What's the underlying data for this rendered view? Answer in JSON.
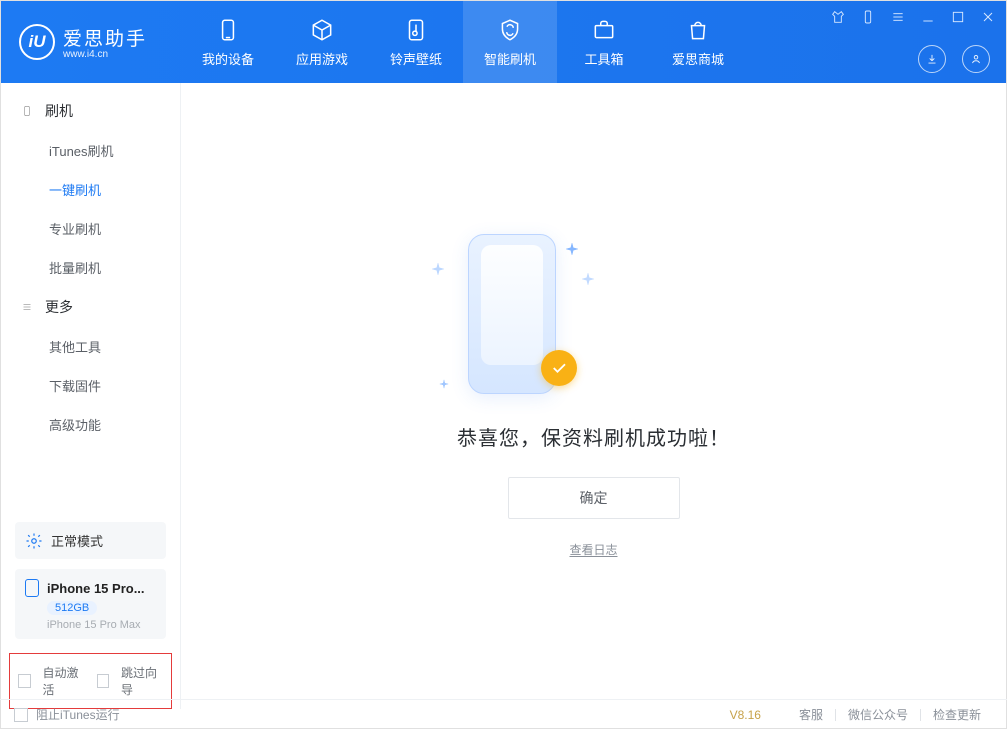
{
  "app": {
    "name": "爱思助手",
    "site": "www.i4.cn"
  },
  "nav": {
    "items": [
      {
        "label": "我的设备"
      },
      {
        "label": "应用游戏"
      },
      {
        "label": "铃声壁纸"
      },
      {
        "label": "智能刷机"
      },
      {
        "label": "工具箱"
      },
      {
        "label": "爱思商城"
      }
    ]
  },
  "sidebar": {
    "group1": "刷机",
    "items1": [
      {
        "label": "iTunes刷机"
      },
      {
        "label": "一键刷机"
      },
      {
        "label": "专业刷机"
      },
      {
        "label": "批量刷机"
      }
    ],
    "group2": "更多",
    "items2": [
      {
        "label": "其他工具"
      },
      {
        "label": "下载固件"
      },
      {
        "label": "高级功能"
      }
    ]
  },
  "status": {
    "mode": "正常模式"
  },
  "device": {
    "name_short": "iPhone 15 Pro...",
    "storage": "512GB",
    "model": "iPhone 15 Pro Max"
  },
  "opts": {
    "auto_activate": "自动激活",
    "skip_guide": "跳过向导"
  },
  "main": {
    "message": "恭喜您，保资料刷机成功啦！",
    "ok": "确定",
    "view_log": "查看日志"
  },
  "footer": {
    "block_itunes": "阻止iTunes运行",
    "version": "V8.16",
    "support": "客服",
    "wechat": "微信公众号",
    "update": "检查更新"
  }
}
